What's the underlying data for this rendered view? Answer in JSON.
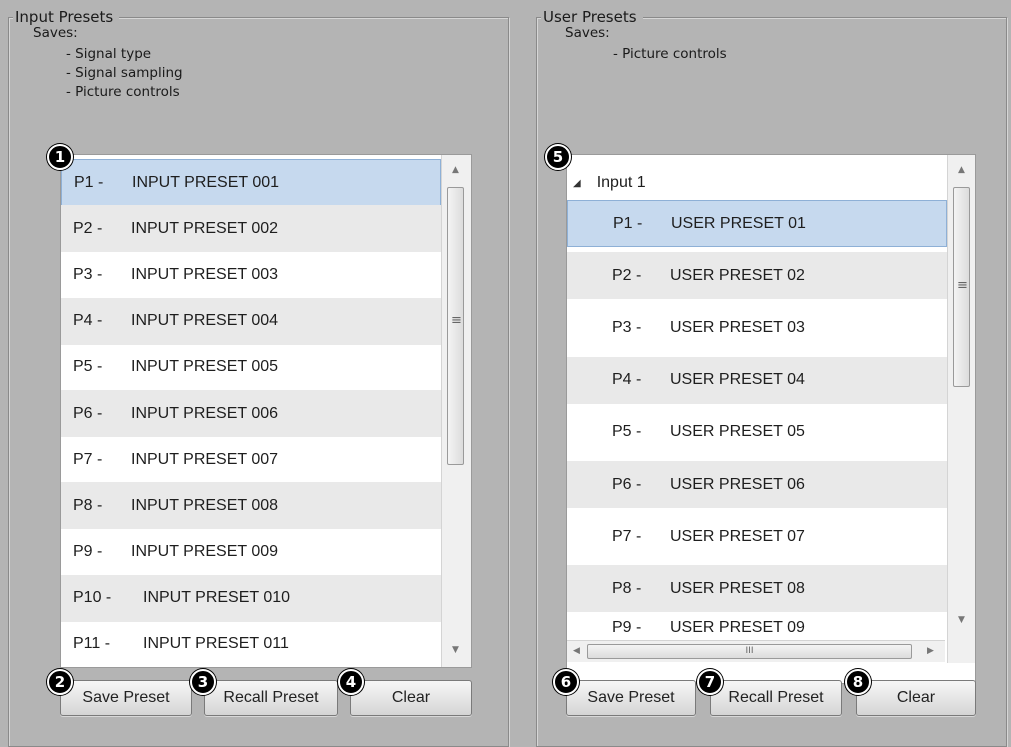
{
  "input_presets": {
    "title": "Input Presets",
    "saves_label": "Saves:",
    "saves_items": [
      "- Signal type",
      "- Signal sampling",
      "- Picture controls"
    ],
    "rows": [
      {
        "code": "P1 -",
        "name": "INPUT PRESET 001"
      },
      {
        "code": "P2 -",
        "name": "INPUT PRESET 002"
      },
      {
        "code": "P3 -",
        "name": "INPUT PRESET 003"
      },
      {
        "code": "P4 -",
        "name": "INPUT PRESET 004"
      },
      {
        "code": "P5 -",
        "name": "INPUT PRESET 005"
      },
      {
        "code": "P6 -",
        "name": "INPUT PRESET 006"
      },
      {
        "code": "P7 -",
        "name": "INPUT PRESET 007"
      },
      {
        "code": "P8 -",
        "name": "INPUT PRESET 008"
      },
      {
        "code": "P9 -",
        "name": "INPUT PRESET 009"
      },
      {
        "code": "P10 -",
        "name": "INPUT PRESET 010"
      },
      {
        "code": "P11 -",
        "name": "INPUT PRESET 011"
      }
    ],
    "buttons": {
      "save": "Save Preset",
      "recall": "Recall Preset",
      "clear": "Clear"
    }
  },
  "user_presets": {
    "title": "User Presets",
    "saves_label": "Saves:",
    "saves_items": [
      "- Picture controls"
    ],
    "group_label": "Input 1",
    "rows": [
      {
        "code": "P1 -",
        "name": "USER PRESET 01"
      },
      {
        "code": "P2 -",
        "name": "USER PRESET 02"
      },
      {
        "code": "P3 -",
        "name": "USER PRESET 03"
      },
      {
        "code": "P4 -",
        "name": "USER PRESET 04"
      },
      {
        "code": "P5 -",
        "name": "USER PRESET 05"
      },
      {
        "code": "P6 -",
        "name": "USER PRESET 06"
      },
      {
        "code": "P7 -",
        "name": "USER PRESET 07"
      },
      {
        "code": "P8 -",
        "name": "USER PRESET 08"
      },
      {
        "code": "P9 -",
        "name": "USER PRESET 09"
      }
    ],
    "buttons": {
      "save": "Save Preset",
      "recall": "Recall Preset",
      "clear": "Clear"
    }
  },
  "callouts": [
    "1",
    "2",
    "3",
    "4",
    "5",
    "6",
    "7",
    "8"
  ],
  "glyphs": {
    "scroll_up": "▲",
    "scroll_down": "▼",
    "scroll_left": "◀",
    "scroll_right": "▶",
    "grip_v": "≡",
    "grip_h": "III",
    "expanded": "◢"
  },
  "colors": {
    "selection": "#c6d9ee",
    "panel": "#b4b4b4",
    "alt_row": "#e9e9e9"
  }
}
